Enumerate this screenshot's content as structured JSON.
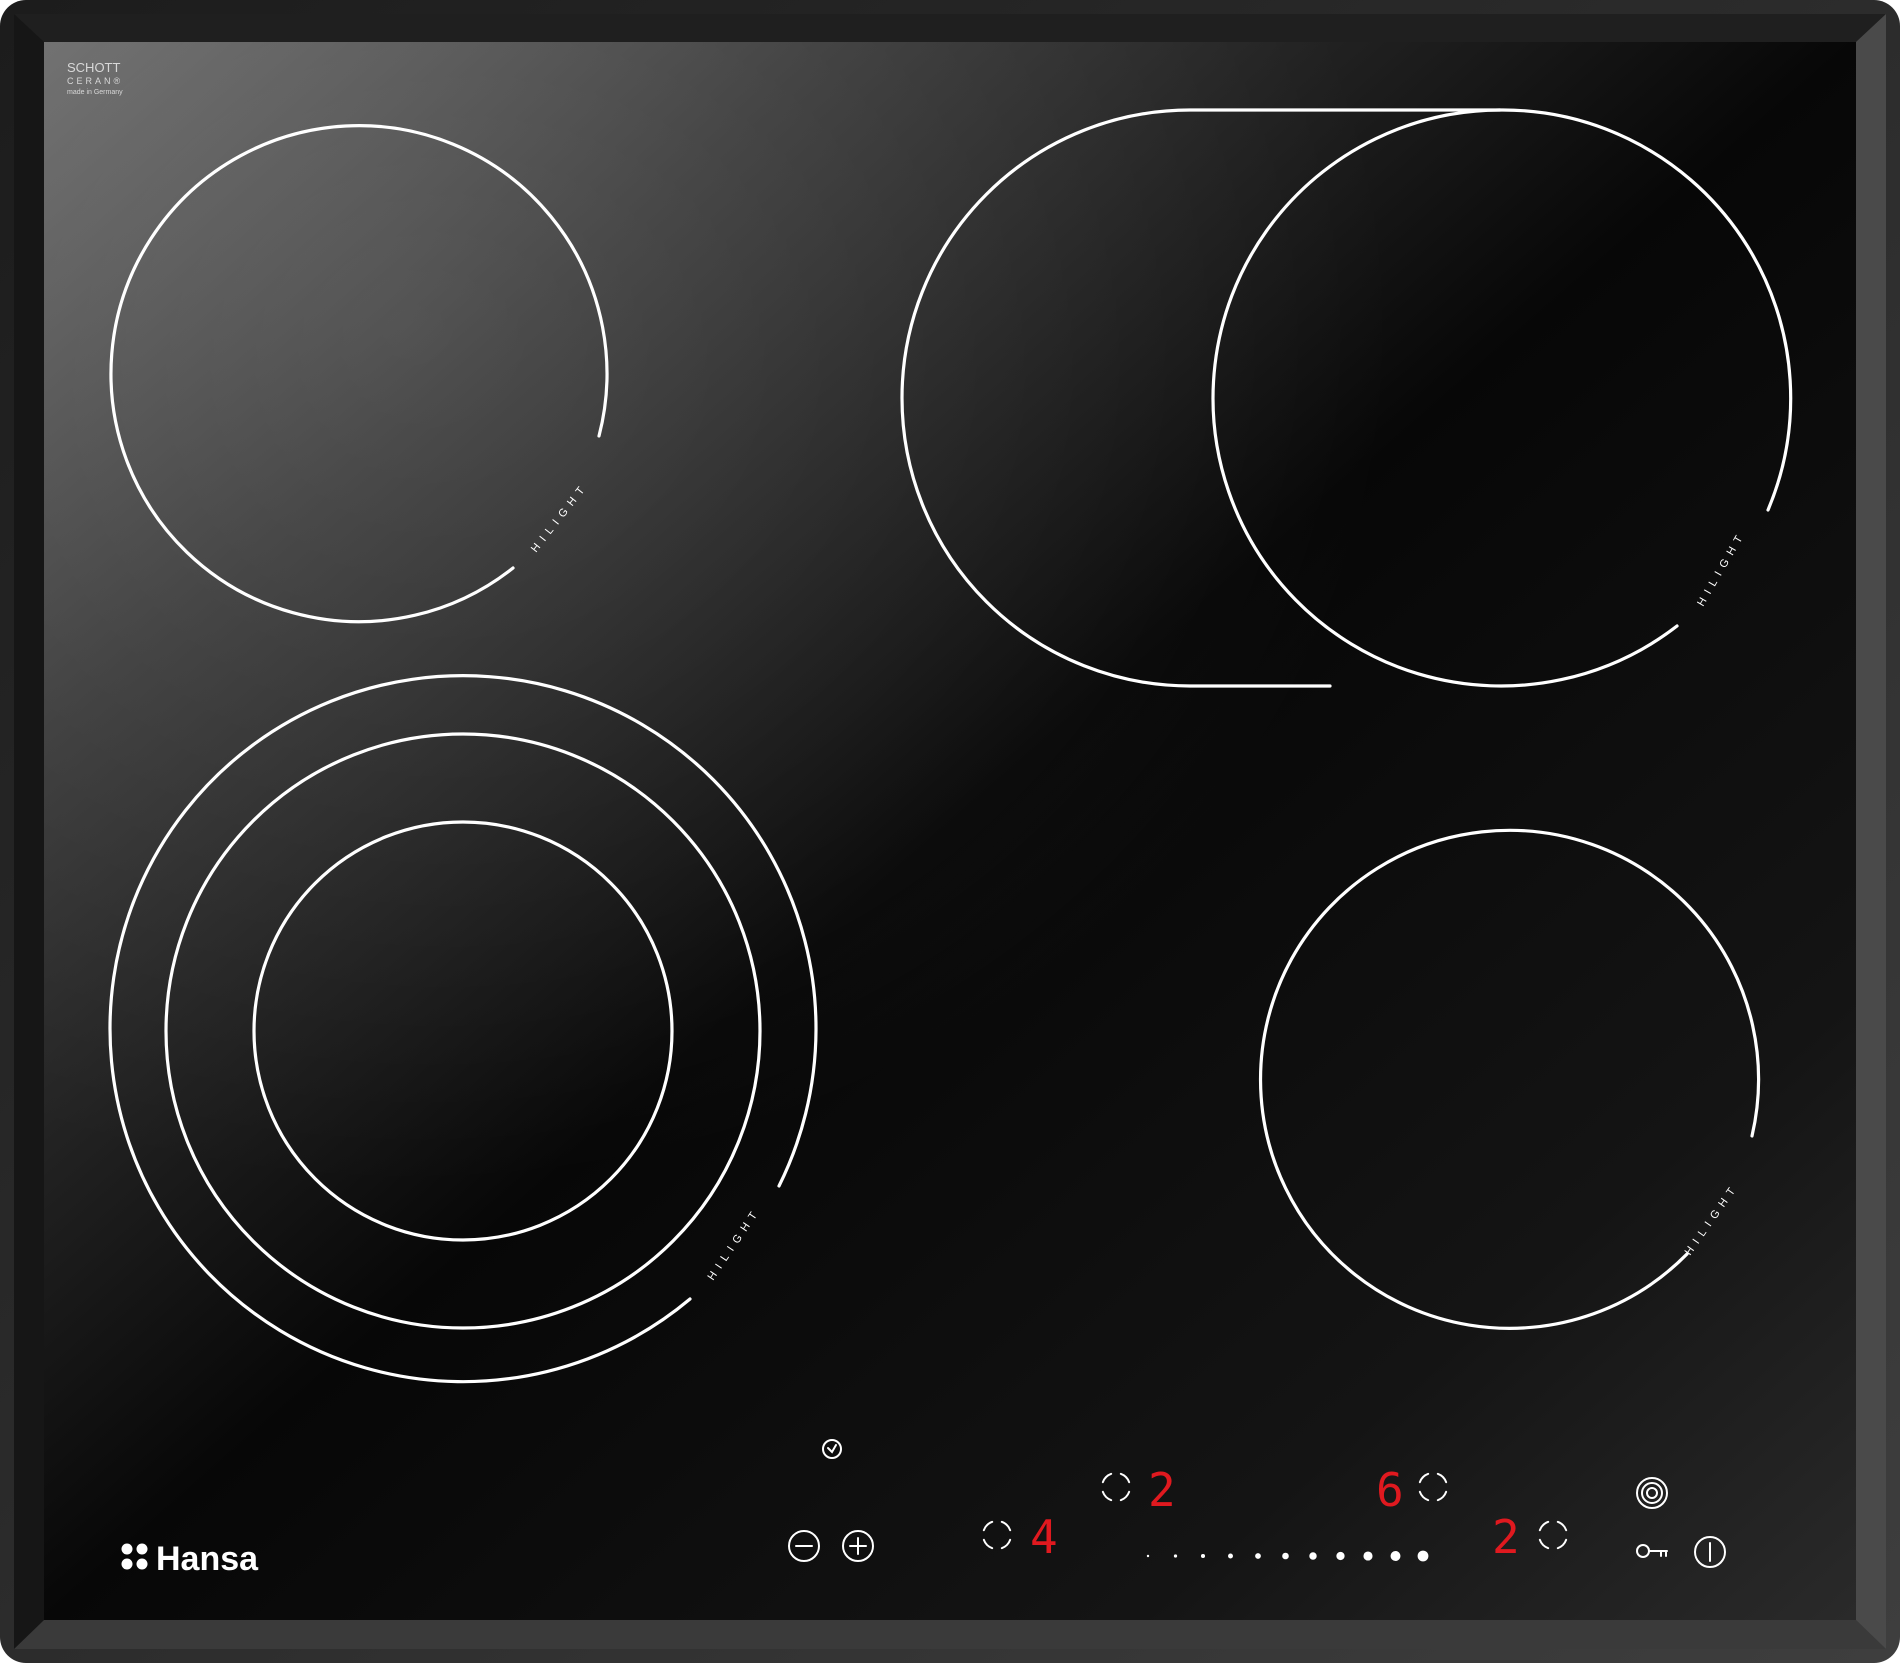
{
  "glass_label": {
    "line1": "SCHOTT",
    "line2": "CERAN®",
    "line3": "made in Germany"
  },
  "zone_label": "HILIGHT",
  "brand": {
    "name": "Hansa"
  },
  "displays": {
    "front_left": "4",
    "rear_left": "2",
    "rear_right": "6",
    "front_right": "2"
  },
  "slider": {
    "dots": 11
  },
  "icons": {
    "timer": "timer-icon",
    "minus": "minus-icon",
    "plus": "plus-icon",
    "zone_selector": "zone-selector-icon",
    "dual_zone": "dual-zone-icon",
    "lock": "key-lock-icon",
    "power": "power-icon"
  },
  "colors": {
    "glass": "#0a0a0a",
    "frame": "#3a3a3a",
    "display_red": "#e0191f",
    "markings": "#ffffff"
  }
}
